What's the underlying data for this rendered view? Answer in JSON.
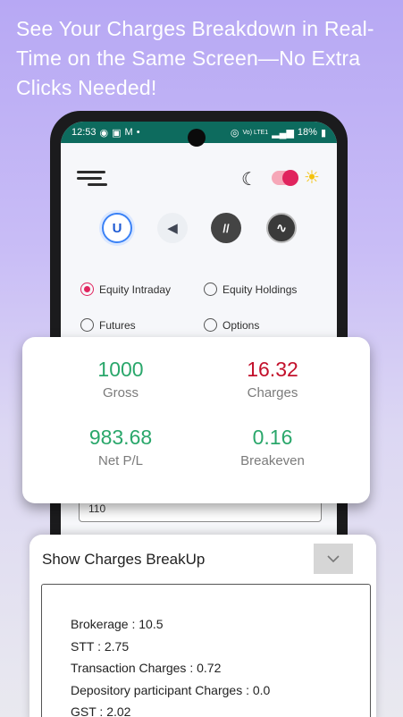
{
  "headline": "See Your Charges Breakdown in Real-Time on the Same Screen—No Extra Clicks Needed!",
  "status": {
    "time": "12:53",
    "battery": "18%",
    "network": "Vo) LTE1"
  },
  "broker_icons": [
    "upstox-icon",
    "kite-icon",
    "angel-icon",
    "groww-icon"
  ],
  "trade_types": [
    {
      "label": "Equity Intraday",
      "selected": true
    },
    {
      "label": "Equity Holdings",
      "selected": false
    },
    {
      "label": "Futures",
      "selected": false
    },
    {
      "label": "Options",
      "selected": false
    }
  ],
  "input_peek": "110",
  "summary": {
    "gross": {
      "value": "1000",
      "label": "Gross"
    },
    "charges": {
      "value": "16.32",
      "label": "Charges"
    },
    "net_pl": {
      "value": "983.68",
      "label": "Net P/L"
    },
    "breakeven": {
      "value": "0.16",
      "label": "Breakeven"
    }
  },
  "breakup": {
    "title": "Show Charges BreakUp",
    "lines": [
      "Brokerage : 10.5",
      "STT : 2.75",
      "Transaction Charges : 0.72",
      "Depository participant Charges : 0.0",
      "GST : 2.02"
    ]
  },
  "colors": {
    "accent": "#e0245e",
    "positive": "#2aa76b",
    "negative": "#c3112c"
  }
}
